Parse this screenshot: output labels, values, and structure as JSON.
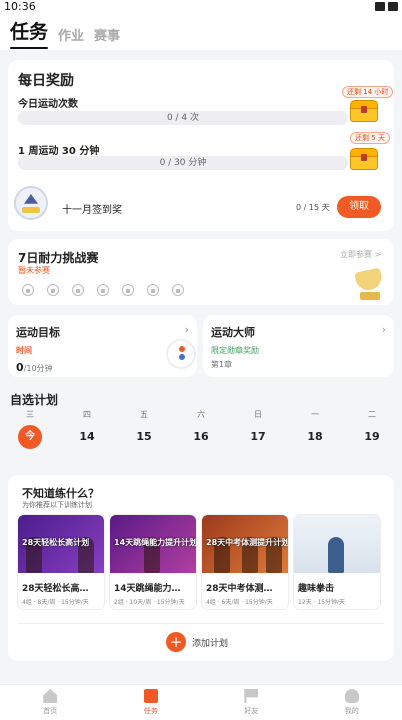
{
  "status_bar": {
    "time": "10:36"
  },
  "top_tabs": [
    {
      "label": "任务",
      "active": true
    },
    {
      "label": "作业",
      "active": false
    },
    {
      "label": "赛事",
      "active": false
    }
  ],
  "daily_reward": {
    "title": "每日奖励",
    "items": [
      {
        "label": "今日运动次数",
        "progress_text": "0 / 4 次",
        "progress": 0,
        "badge": "还剩 14 小时"
      },
      {
        "label": "1 周运动 30 分钟",
        "progress_text": "0 / 30 分钟",
        "progress": 0,
        "badge": "还剩 5 天"
      }
    ],
    "signin": {
      "label": "十一月签到奖",
      "count": "0 / 15 天",
      "button": "领取"
    }
  },
  "challenge": {
    "title": "7日耐力挑战赛",
    "status": "暂未参赛",
    "join_link": "立即参赛 >",
    "days_locked": 7
  },
  "goal": {
    "title": "运动目标",
    "tag": "时间",
    "value": "0",
    "unit": "/10分钟"
  },
  "master": {
    "title": "运动大师",
    "tag": "限定勋章奖励",
    "sub": "第1章"
  },
  "plan_section": {
    "title": "自选计划",
    "week": [
      {
        "weekday": "三",
        "day": "今",
        "today": true
      },
      {
        "weekday": "四",
        "day": "14"
      },
      {
        "weekday": "五",
        "day": "15"
      },
      {
        "weekday": "六",
        "day": "16"
      },
      {
        "weekday": "日",
        "day": "17"
      },
      {
        "weekday": "一",
        "day": "18"
      },
      {
        "weekday": "二",
        "day": "19"
      }
    ]
  },
  "recommend": {
    "title": "不知道练什么？",
    "subtitle": "为你推荐以下训练计划",
    "plans": [
      {
        "name": "28天轻松长高…",
        "meta": "4组 · 8天/周 · 15分钟/天",
        "overlay": "28天轻松长高计划",
        "color": "#6b2fa8"
      },
      {
        "name": "14天跳绳能力…",
        "meta": "2组 · 10天/周 · 15分钟/天",
        "overlay": "14天跳绳能力提升计划",
        "color": "#8e2f9e"
      },
      {
        "name": "28天中考体测…",
        "meta": "4组 · 6天/周 · 15分钟/天",
        "overlay": "28天中考体测提升计划",
        "color": "#c2552a"
      },
      {
        "name": "趣味拳击",
        "meta": "12天 · 15分钟/天",
        "overlay": "",
        "color": "#e4ebf2"
      }
    ],
    "add_label": "添加计划"
  },
  "tabbar": [
    {
      "label": "首页",
      "icon": "home-icon",
      "active": false
    },
    {
      "label": "任务",
      "icon": "task-icon",
      "active": true
    },
    {
      "label": "好友",
      "icon": "flag-icon",
      "active": false
    },
    {
      "label": "我的",
      "icon": "user-icon",
      "active": false
    }
  ],
  "colors": {
    "accent": "#f15a24",
    "green": "#3aa15c"
  }
}
